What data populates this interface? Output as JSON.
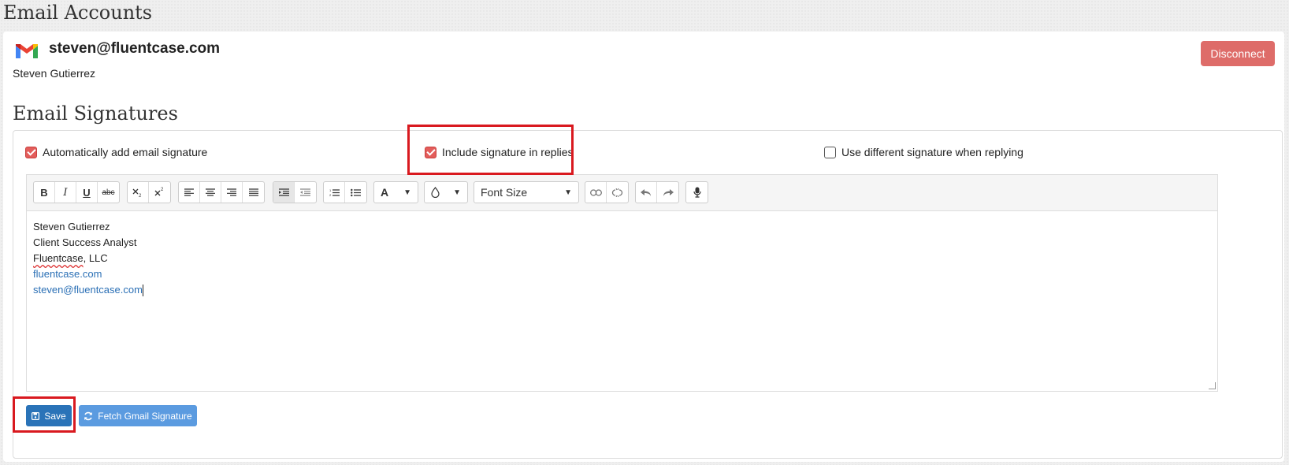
{
  "page": {
    "title": "Email Accounts"
  },
  "account": {
    "email": "steven@fluentcase.com",
    "name": "Steven Gutierrez",
    "disconnect_label": "Disconnect",
    "provider_icon": "gmail-icon"
  },
  "signatures": {
    "title": "Email Signatures",
    "options": {
      "auto_add": {
        "label": "Automatically add email signature",
        "checked": true
      },
      "include_replies": {
        "label": "Include signature in replies",
        "checked": true
      },
      "different_reply": {
        "label": "Use different signature when replying",
        "checked": false
      }
    },
    "toolbar": {
      "bold": "B",
      "italic": "I",
      "underline": "U",
      "strikethrough": "abc",
      "font_color": "A",
      "font_size_label": "Font Size"
    },
    "content": {
      "line1": "Steven Gutierrez",
      "line2": "Client Success Analyst",
      "line3_word": "Fluentcase",
      "line3_rest": ", LLC",
      "line4": "fluentcase.com",
      "line5": "steven@fluentcase.com"
    },
    "save_label": "Save",
    "fetch_label": "Fetch Gmail Signature"
  },
  "colors": {
    "accent_checkbox": "#e35d5b",
    "save_button": "#2a73b8",
    "fetch_button": "#5b9be0",
    "disconnect_button": "#d9534f",
    "highlight": "#d9191f"
  }
}
